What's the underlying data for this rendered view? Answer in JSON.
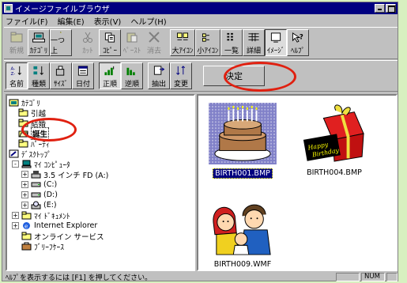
{
  "window": {
    "title": "イメージファイルブラウザ"
  },
  "menu": [
    "ファイル(F)",
    "編集(E)",
    "表示(V)",
    "ヘルプ(H)"
  ],
  "toolbar1": [
    {
      "label": "新規",
      "icon": "new-folder-icon",
      "state": "disabled"
    },
    {
      "label": "ｶﾃｺﾞﾘ",
      "icon": "category-icon",
      "state": "raised"
    },
    {
      "label": "一つ上",
      "icon": "up-folder-icon",
      "state": "raised"
    },
    {
      "label": "ｶｯﾄ",
      "icon": "cut-icon",
      "state": "disabled"
    },
    {
      "label": "ｺﾋﾟｰ",
      "icon": "copy-icon",
      "state": "raised"
    },
    {
      "label": "ﾍﾟｰｽﾄ",
      "icon": "paste-icon",
      "state": "disabled"
    },
    {
      "label": "消去",
      "icon": "delete-icon",
      "state": "disabled"
    },
    {
      "label": "大ｱｲｺﾝ",
      "icon": "large-icons-icon",
      "state": "raised"
    },
    {
      "label": "小ｱｲｺﾝ",
      "icon": "small-icons-icon",
      "state": "raised"
    },
    {
      "label": "一覧",
      "icon": "list-icon",
      "state": "raised"
    },
    {
      "label": "詳細",
      "icon": "details-icon",
      "state": "raised"
    },
    {
      "label": "ｲﾒｰｼﾞ",
      "icon": "image-view-icon",
      "state": "pressed"
    },
    {
      "label": "ﾍﾙﾌﾟ",
      "icon": "help-icon",
      "state": "raised"
    }
  ],
  "toolbar2": [
    {
      "label": "名前",
      "icon": "sort-name-icon",
      "state": "pressed"
    },
    {
      "label": "種類",
      "icon": "sort-type-icon",
      "state": "raised"
    },
    {
      "label": "ｻｲｽﾞ",
      "icon": "sort-size-icon",
      "state": "raised"
    },
    {
      "label": "日付",
      "icon": "sort-date-icon",
      "state": "raised"
    },
    {
      "label": "正順",
      "icon": "ascending-icon",
      "state": "pressed"
    },
    {
      "label": "逆順",
      "icon": "descending-icon",
      "state": "raised"
    },
    {
      "label": "抽出",
      "icon": "extract-icon",
      "state": "raised"
    },
    {
      "label": "変更",
      "icon": "change-icon",
      "state": "raised"
    }
  ],
  "decide_label": "決定",
  "tree": [
    {
      "label": "ｶﾃｺﾞﾘ",
      "level": 0,
      "icon": "category-folder-icon"
    },
    {
      "label": "引越",
      "level": 1,
      "icon": "folder-icon"
    },
    {
      "label": "結婚",
      "level": 1,
      "icon": "folder-icon"
    },
    {
      "label": "誕生",
      "level": 1,
      "icon": "open-folder-icon",
      "selected": true
    },
    {
      "label": "ﾊﾟｰﾃｨ",
      "level": 1,
      "icon": "folder-icon"
    },
    {
      "label": "ﾃﾞｽｸﾄｯﾌﾟ",
      "level": 0,
      "icon": "desktop-icon"
    },
    {
      "label": "ﾏｲ ｺﾝﾋﾟｭｰﾀ",
      "level": 1,
      "icon": "computer-icon",
      "pm": "-"
    },
    {
      "label": "3.5 インチ FD (A:)",
      "level": 2,
      "icon": "floppy-icon",
      "pm": "+"
    },
    {
      "label": "(C:)",
      "level": 2,
      "icon": "drive-icon",
      "pm": "+"
    },
    {
      "label": "(D:)",
      "level": 2,
      "icon": "drive-icon",
      "pm": "+"
    },
    {
      "label": "(E:)",
      "level": 2,
      "icon": "cdrom-icon",
      "pm": "+"
    },
    {
      "label": "ﾏｲ ﾄﾞｷｭﾒﾝﾄ",
      "level": 1,
      "icon": "folder-icon",
      "pm": "+"
    },
    {
      "label": "Internet Explorer",
      "level": 1,
      "icon": "ie-icon",
      "pm": "+"
    },
    {
      "label": "オンライン サービス",
      "level": 1,
      "icon": "folder-icon"
    },
    {
      "label": "ﾌﾞﾘｰﾌｹｰｽ",
      "level": 1,
      "icon": "briefcase-icon"
    }
  ],
  "thumbnails": [
    {
      "caption": "BIRTH001.BMP",
      "selected": true,
      "icon": "birthday-cake-icon"
    },
    {
      "caption": "BIRTH004.BMP",
      "selected": false,
      "icon": "gift-box-icon"
    },
    {
      "caption": "BIRTH009.WMF",
      "selected": false,
      "icon": "family-icon"
    }
  ],
  "status": {
    "message": "ﾍﾙﾌﾟを表示するには [F1] を押してください。",
    "num": "NUM"
  },
  "colors": {
    "title_bg": "#000080",
    "highlight": "#e02010",
    "face": "#c0c0c0"
  }
}
